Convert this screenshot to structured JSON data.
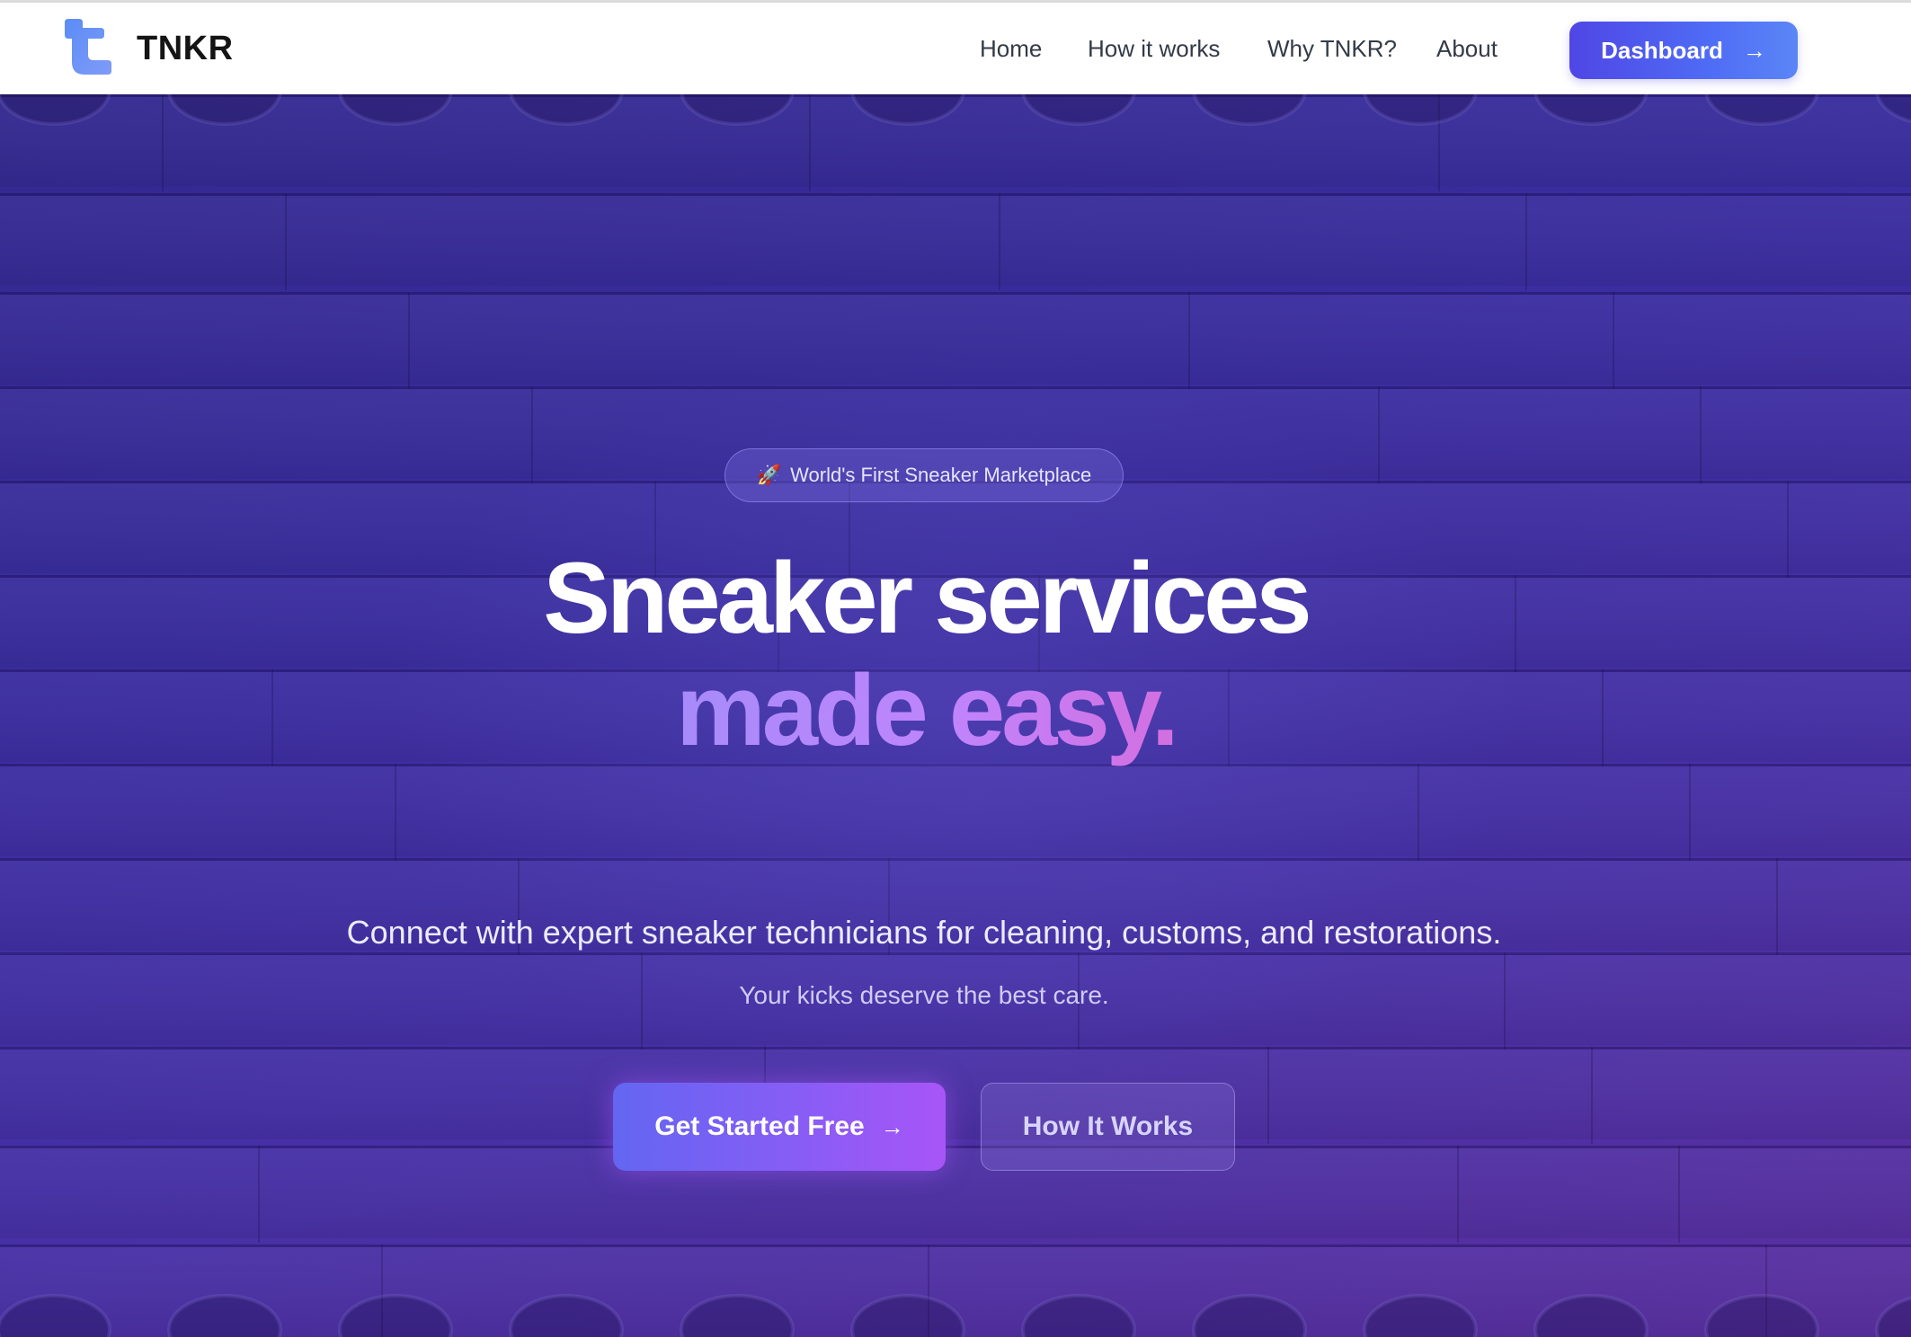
{
  "navbar": {
    "brand": "TNKR",
    "links": [
      "Home",
      "How it works",
      "Why TNKR?",
      "About"
    ],
    "dashboard_label": "Dashboard",
    "dashboard_icon": "arrow-right-icon",
    "logo_color": "#6d8af6"
  },
  "hero": {
    "badge_icon": "🚀",
    "badge_text": "World's First Sneaker Marketplace",
    "headline_line1": "Sneaker services",
    "headline_line2": "made easy.",
    "subtitle": "Connect with expert sneaker technicians for cleaning, customs, and restorations.",
    "tagline": "Your kicks deserve the best care.",
    "primary_cta": "Get Started Free",
    "primary_cta_icon": "arrow-right-icon",
    "secondary_cta": "How It Works",
    "background_image": "wooden-planks-with-sneakers"
  },
  "colors": {
    "accent": "#4f46e5",
    "hero_bg": "#3a2da0",
    "gradient_text_start": "#a78bfa",
    "gradient_text_end": "#d36fe0"
  }
}
